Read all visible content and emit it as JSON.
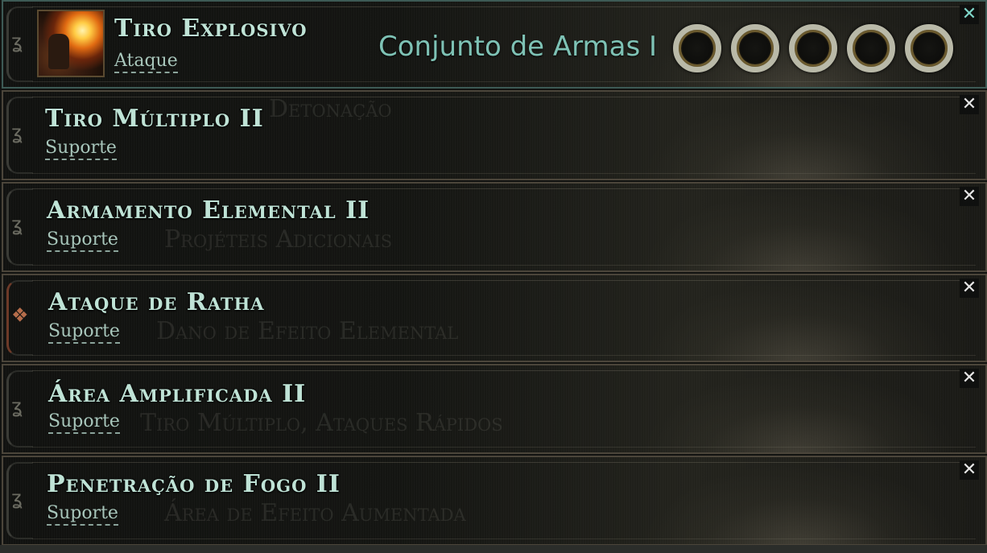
{
  "skill": {
    "name": "Tiro Explosivo",
    "type": "Ataque",
    "set_label": "Conjunto de Armas I",
    "sockets": [
      "socket-1",
      "socket-2",
      "socket-3",
      "socket-4",
      "socket-5"
    ],
    "close_icon": "close-icon",
    "close_glyph": "✕"
  },
  "supports": [
    {
      "name": "Tiro Múltiplo II",
      "type": "Suporte",
      "ghost": "Detonação",
      "close_glyph": "✕"
    },
    {
      "name": "Armamento Elemental II",
      "type": "Suporte",
      "ghost": "Projéteis Adicionais",
      "close_glyph": "✕"
    },
    {
      "name": "Ataque de Ratha",
      "type": "Suporte",
      "ghost": "Dano de Efeito Elemental",
      "close_glyph": "✕"
    },
    {
      "name": "Área Amplificada II",
      "type": "Suporte",
      "ghost": "Tiro Múltiplo, Ataques Rápidos",
      "close_glyph": "✕"
    },
    {
      "name": "Penetração de Fogo II",
      "type": "Suporte",
      "ghost": "Área de Efeito Aumentada",
      "close_glyph": "✕"
    }
  ],
  "colors": {
    "title": "#bfe3d6",
    "set_label": "#7ec2b5",
    "border_active": "#3d5a55",
    "border": "#4b453a"
  }
}
